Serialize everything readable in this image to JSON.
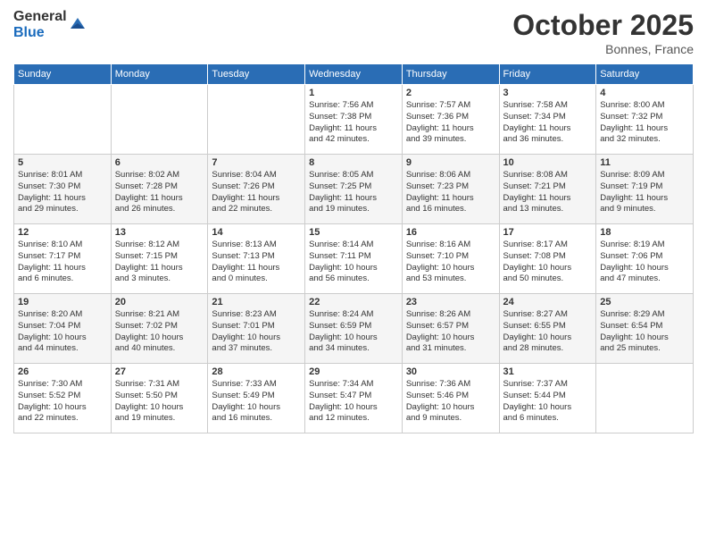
{
  "logo": {
    "general": "General",
    "blue": "Blue"
  },
  "header": {
    "month": "October 2025",
    "location": "Bonnes, France"
  },
  "weekdays": [
    "Sunday",
    "Monday",
    "Tuesday",
    "Wednesday",
    "Thursday",
    "Friday",
    "Saturday"
  ],
  "weeks": [
    [
      {
        "day": "",
        "info": ""
      },
      {
        "day": "",
        "info": ""
      },
      {
        "day": "",
        "info": ""
      },
      {
        "day": "1",
        "info": "Sunrise: 7:56 AM\nSunset: 7:38 PM\nDaylight: 11 hours\nand 42 minutes."
      },
      {
        "day": "2",
        "info": "Sunrise: 7:57 AM\nSunset: 7:36 PM\nDaylight: 11 hours\nand 39 minutes."
      },
      {
        "day": "3",
        "info": "Sunrise: 7:58 AM\nSunset: 7:34 PM\nDaylight: 11 hours\nand 36 minutes."
      },
      {
        "day": "4",
        "info": "Sunrise: 8:00 AM\nSunset: 7:32 PM\nDaylight: 11 hours\nand 32 minutes."
      }
    ],
    [
      {
        "day": "5",
        "info": "Sunrise: 8:01 AM\nSunset: 7:30 PM\nDaylight: 11 hours\nand 29 minutes."
      },
      {
        "day": "6",
        "info": "Sunrise: 8:02 AM\nSunset: 7:28 PM\nDaylight: 11 hours\nand 26 minutes."
      },
      {
        "day": "7",
        "info": "Sunrise: 8:04 AM\nSunset: 7:26 PM\nDaylight: 11 hours\nand 22 minutes."
      },
      {
        "day": "8",
        "info": "Sunrise: 8:05 AM\nSunset: 7:25 PM\nDaylight: 11 hours\nand 19 minutes."
      },
      {
        "day": "9",
        "info": "Sunrise: 8:06 AM\nSunset: 7:23 PM\nDaylight: 11 hours\nand 16 minutes."
      },
      {
        "day": "10",
        "info": "Sunrise: 8:08 AM\nSunset: 7:21 PM\nDaylight: 11 hours\nand 13 minutes."
      },
      {
        "day": "11",
        "info": "Sunrise: 8:09 AM\nSunset: 7:19 PM\nDaylight: 11 hours\nand 9 minutes."
      }
    ],
    [
      {
        "day": "12",
        "info": "Sunrise: 8:10 AM\nSunset: 7:17 PM\nDaylight: 11 hours\nand 6 minutes."
      },
      {
        "day": "13",
        "info": "Sunrise: 8:12 AM\nSunset: 7:15 PM\nDaylight: 11 hours\nand 3 minutes."
      },
      {
        "day": "14",
        "info": "Sunrise: 8:13 AM\nSunset: 7:13 PM\nDaylight: 11 hours\nand 0 minutes."
      },
      {
        "day": "15",
        "info": "Sunrise: 8:14 AM\nSunset: 7:11 PM\nDaylight: 10 hours\nand 56 minutes."
      },
      {
        "day": "16",
        "info": "Sunrise: 8:16 AM\nSunset: 7:10 PM\nDaylight: 10 hours\nand 53 minutes."
      },
      {
        "day": "17",
        "info": "Sunrise: 8:17 AM\nSunset: 7:08 PM\nDaylight: 10 hours\nand 50 minutes."
      },
      {
        "day": "18",
        "info": "Sunrise: 8:19 AM\nSunset: 7:06 PM\nDaylight: 10 hours\nand 47 minutes."
      }
    ],
    [
      {
        "day": "19",
        "info": "Sunrise: 8:20 AM\nSunset: 7:04 PM\nDaylight: 10 hours\nand 44 minutes."
      },
      {
        "day": "20",
        "info": "Sunrise: 8:21 AM\nSunset: 7:02 PM\nDaylight: 10 hours\nand 40 minutes."
      },
      {
        "day": "21",
        "info": "Sunrise: 8:23 AM\nSunset: 7:01 PM\nDaylight: 10 hours\nand 37 minutes."
      },
      {
        "day": "22",
        "info": "Sunrise: 8:24 AM\nSunset: 6:59 PM\nDaylight: 10 hours\nand 34 minutes."
      },
      {
        "day": "23",
        "info": "Sunrise: 8:26 AM\nSunset: 6:57 PM\nDaylight: 10 hours\nand 31 minutes."
      },
      {
        "day": "24",
        "info": "Sunrise: 8:27 AM\nSunset: 6:55 PM\nDaylight: 10 hours\nand 28 minutes."
      },
      {
        "day": "25",
        "info": "Sunrise: 8:29 AM\nSunset: 6:54 PM\nDaylight: 10 hours\nand 25 minutes."
      }
    ],
    [
      {
        "day": "26",
        "info": "Sunrise: 7:30 AM\nSunset: 5:52 PM\nDaylight: 10 hours\nand 22 minutes."
      },
      {
        "day": "27",
        "info": "Sunrise: 7:31 AM\nSunset: 5:50 PM\nDaylight: 10 hours\nand 19 minutes."
      },
      {
        "day": "28",
        "info": "Sunrise: 7:33 AM\nSunset: 5:49 PM\nDaylight: 10 hours\nand 16 minutes."
      },
      {
        "day": "29",
        "info": "Sunrise: 7:34 AM\nSunset: 5:47 PM\nDaylight: 10 hours\nand 12 minutes."
      },
      {
        "day": "30",
        "info": "Sunrise: 7:36 AM\nSunset: 5:46 PM\nDaylight: 10 hours\nand 9 minutes."
      },
      {
        "day": "31",
        "info": "Sunrise: 7:37 AM\nSunset: 5:44 PM\nDaylight: 10 hours\nand 6 minutes."
      },
      {
        "day": "",
        "info": ""
      }
    ]
  ]
}
